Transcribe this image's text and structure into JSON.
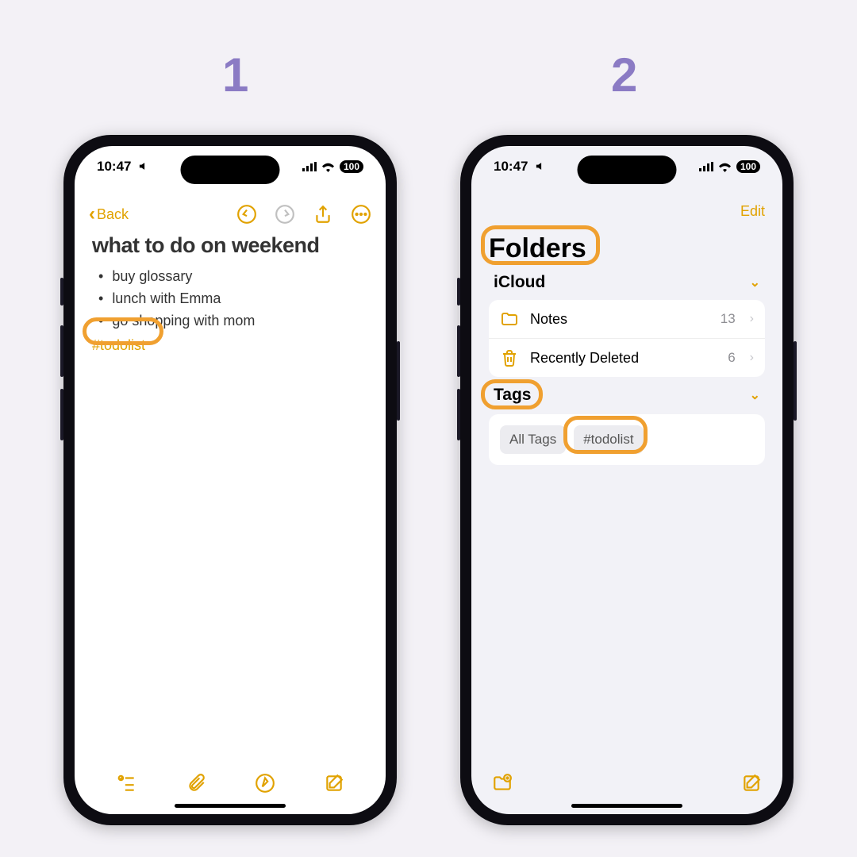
{
  "steps": {
    "one": "1",
    "two": "2"
  },
  "status": {
    "time": "10:47",
    "battery": "100"
  },
  "phone1": {
    "back": "Back",
    "title": "what to do on weekend",
    "bullets": [
      "buy glossary",
      "lunch with Emma",
      "go shopping with mom"
    ],
    "hashtag": "#todolist"
  },
  "phone2": {
    "edit": "Edit",
    "foldersTitle": "Folders",
    "icloud": "iCloud",
    "folders": [
      {
        "name": "Notes",
        "count": "13"
      },
      {
        "name": "Recently Deleted",
        "count": "6"
      }
    ],
    "tagsTitle": "Tags",
    "tags": [
      "All Tags",
      "#todolist"
    ]
  }
}
